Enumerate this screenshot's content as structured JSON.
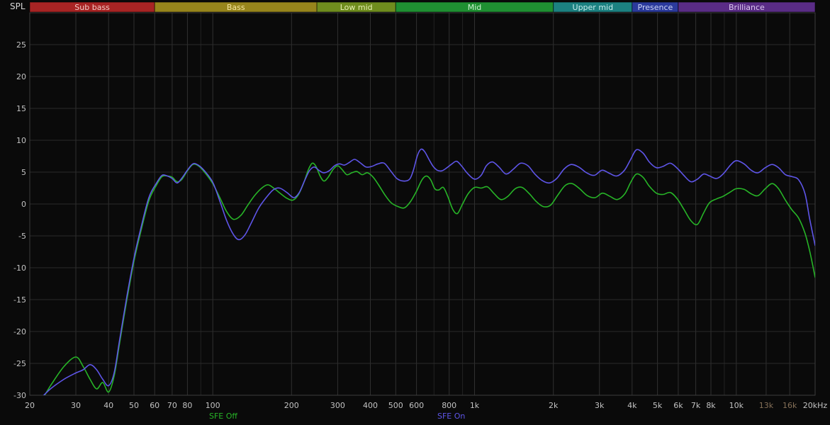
{
  "chart_data": {
    "type": "line",
    "title": "",
    "ylabel": "SPL",
    "x_axis": {
      "scale": "log",
      "min": 20,
      "max": 20000,
      "gridlines": [
        20,
        30,
        40,
        50,
        60,
        70,
        80,
        90,
        100,
        200,
        300,
        400,
        500,
        600,
        700,
        800,
        900,
        1000,
        2000,
        3000,
        4000,
        5000,
        6000,
        7000,
        8000,
        9000,
        10000,
        13000,
        16000,
        20000
      ],
      "tick_labels": [
        {
          "f": 20,
          "label": "20"
        },
        {
          "f": 30,
          "label": "30"
        },
        {
          "f": 40,
          "label": "40"
        },
        {
          "f": 50,
          "label": "50"
        },
        {
          "f": 60,
          "label": "60"
        },
        {
          "f": 70,
          "label": "70"
        },
        {
          "f": 80,
          "label": "80"
        },
        {
          "f": 100,
          "label": "100"
        },
        {
          "f": 200,
          "label": "200"
        },
        {
          "f": 300,
          "label": "300"
        },
        {
          "f": 400,
          "label": "400"
        },
        {
          "f": 500,
          "label": "500"
        },
        {
          "f": 600,
          "label": "600"
        },
        {
          "f": 800,
          "label": "800"
        },
        {
          "f": 1000,
          "label": "1k"
        },
        {
          "f": 2000,
          "label": "2k"
        },
        {
          "f": 3000,
          "label": "3k"
        },
        {
          "f": 4000,
          "label": "4k"
        },
        {
          "f": 5000,
          "label": "5k"
        },
        {
          "f": 6000,
          "label": "6k"
        },
        {
          "f": 7000,
          "label": "7k"
        },
        {
          "f": 8000,
          "label": "8k"
        },
        {
          "f": 10000,
          "label": "10k"
        },
        {
          "f": 13000,
          "label": "13k",
          "dim": true
        },
        {
          "f": 16000,
          "label": "16k",
          "dim": true
        },
        {
          "f": 20000,
          "label": "20kHz"
        }
      ]
    },
    "y_axis": {
      "min": -30,
      "max": 30,
      "step": 5,
      "labels": [
        25,
        20,
        15,
        10,
        5,
        0,
        -5,
        -10,
        -15,
        -20,
        -25,
        -30
      ]
    },
    "bands": [
      {
        "label": "Sub bass",
        "from": 20,
        "to": 60,
        "color": "#a82424",
        "text_color": "#f2ccc6"
      },
      {
        "label": "Bass",
        "from": 60,
        "to": 250,
        "color": "#97851c",
        "text_color": "#f5e6a0"
      },
      {
        "label": "Low mid",
        "from": 250,
        "to": 500,
        "color": "#6f8d1e",
        "text_color": "#e6f0b2"
      },
      {
        "label": "Mid",
        "from": 500,
        "to": 2000,
        "color": "#1f9032",
        "text_color": "#ccf2d0"
      },
      {
        "label": "Upper mid",
        "from": 2000,
        "to": 4000,
        "color": "#1c8181",
        "text_color": "#c6ecec"
      },
      {
        "label": "Presence",
        "from": 4000,
        "to": 6000,
        "color": "#2b3a9c",
        "text_color": "#ccd4f5"
      },
      {
        "label": "Brilliance",
        "from": 6000,
        "to": 20000,
        "color": "#5a2c86",
        "text_color": "#ddc9f0"
      }
    ],
    "series": [
      {
        "name": "SFE Off",
        "color": "#27b427",
        "points": [
          [
            20,
            -33
          ],
          [
            22,
            -31
          ],
          [
            24,
            -28.5
          ],
          [
            27,
            -25.5
          ],
          [
            30,
            -24
          ],
          [
            32,
            -25.5
          ],
          [
            34,
            -27.5
          ],
          [
            36,
            -29
          ],
          [
            38,
            -28
          ],
          [
            40,
            -29.5
          ],
          [
            42,
            -27
          ],
          [
            44,
            -22
          ],
          [
            47,
            -15
          ],
          [
            50,
            -9
          ],
          [
            53,
            -4.5
          ],
          [
            57,
            0.5
          ],
          [
            61,
            3
          ],
          [
            64,
            4.3
          ],
          [
            67,
            4.4
          ],
          [
            70,
            4.2
          ],
          [
            73,
            3.5
          ],
          [
            76,
            3.8
          ],
          [
            80,
            5.2
          ],
          [
            84,
            6.2
          ],
          [
            88,
            6
          ],
          [
            93,
            5
          ],
          [
            100,
            3.2
          ],
          [
            107,
            0.8
          ],
          [
            113,
            -1.2
          ],
          [
            120,
            -2.4
          ],
          [
            128,
            -1.8
          ],
          [
            136,
            -0.2
          ],
          [
            145,
            1.4
          ],
          [
            155,
            2.6
          ],
          [
            163,
            3
          ],
          [
            172,
            2.4
          ],
          [
            182,
            1.6
          ],
          [
            192,
            0.9
          ],
          [
            202,
            0.6
          ],
          [
            212,
            1.4
          ],
          [
            222,
            3.2
          ],
          [
            232,
            5.4
          ],
          [
            240,
            6.4
          ],
          [
            248,
            5.9
          ],
          [
            257,
            4.4
          ],
          [
            266,
            3.6
          ],
          [
            276,
            4.2
          ],
          [
            288,
            5.4
          ],
          [
            300,
            6
          ],
          [
            312,
            5.4
          ],
          [
            325,
            4.6
          ],
          [
            340,
            4.9
          ],
          [
            355,
            5.1
          ],
          [
            372,
            4.6
          ],
          [
            390,
            4.9
          ],
          [
            410,
            4.2
          ],
          [
            430,
            3
          ],
          [
            455,
            1.4
          ],
          [
            480,
            0.2
          ],
          [
            510,
            -0.4
          ],
          [
            540,
            -0.6
          ],
          [
            570,
            0.4
          ],
          [
            600,
            2
          ],
          [
            630,
            3.8
          ],
          [
            655,
            4.4
          ],
          [
            680,
            3.8
          ],
          [
            705,
            2.4
          ],
          [
            730,
            2.2
          ],
          [
            760,
            2.6
          ],
          [
            790,
            1.2
          ],
          [
            825,
            -0.8
          ],
          [
            860,
            -1.5
          ],
          [
            900,
            0
          ],
          [
            945,
            1.6
          ],
          [
            1000,
            2.6
          ],
          [
            1060,
            2.5
          ],
          [
            1120,
            2.7
          ],
          [
            1190,
            1.6
          ],
          [
            1260,
            0.7
          ],
          [
            1340,
            1.2
          ],
          [
            1430,
            2.4
          ],
          [
            1520,
            2.6
          ],
          [
            1620,
            1.6
          ],
          [
            1720,
            0.4
          ],
          [
            1830,
            -0.4
          ],
          [
            1950,
            -0.2
          ],
          [
            2080,
            1.4
          ],
          [
            2220,
            2.9
          ],
          [
            2360,
            3.2
          ],
          [
            2520,
            2.4
          ],
          [
            2700,
            1.3
          ],
          [
            2890,
            1
          ],
          [
            3080,
            1.7
          ],
          [
            3290,
            1.2
          ],
          [
            3510,
            0.7
          ],
          [
            3750,
            1.6
          ],
          [
            3950,
            3.4
          ],
          [
            4150,
            4.7
          ],
          [
            4400,
            4.2
          ],
          [
            4650,
            2.8
          ],
          [
            4950,
            1.7
          ],
          [
            5250,
            1.5
          ],
          [
            5600,
            1.8
          ],
          [
            5950,
            0.8
          ],
          [
            6300,
            -0.8
          ],
          [
            6700,
            -2.6
          ],
          [
            7100,
            -3.2
          ],
          [
            7500,
            -1.4
          ],
          [
            7900,
            0.2
          ],
          [
            8400,
            0.8
          ],
          [
            8900,
            1.2
          ],
          [
            9500,
            1.9
          ],
          [
            10000,
            2.4
          ],
          [
            10700,
            2.3
          ],
          [
            11400,
            1.6
          ],
          [
            12100,
            1.3
          ],
          [
            12900,
            2.4
          ],
          [
            13700,
            3.2
          ],
          [
            14500,
            2.4
          ],
          [
            15400,
            0.6
          ],
          [
            16300,
            -0.9
          ],
          [
            17300,
            -2.2
          ],
          [
            18300,
            -4.6
          ],
          [
            19100,
            -7.5
          ],
          [
            20000,
            -11.5
          ]
        ]
      },
      {
        "name": "SFE On",
        "color": "#5e55e8",
        "points": [
          [
            20,
            -32
          ],
          [
            22,
            -30.5
          ],
          [
            24,
            -29
          ],
          [
            27,
            -27.5
          ],
          [
            30,
            -26.5
          ],
          [
            32,
            -26
          ],
          [
            34,
            -25.2
          ],
          [
            36,
            -26
          ],
          [
            38,
            -27.5
          ],
          [
            40,
            -28.5
          ],
          [
            42,
            -26.5
          ],
          [
            44,
            -21.5
          ],
          [
            47,
            -14.5
          ],
          [
            50,
            -8.5
          ],
          [
            53,
            -4
          ],
          [
            57,
            1
          ],
          [
            61,
            3.3
          ],
          [
            64,
            4.5
          ],
          [
            67,
            4.4
          ],
          [
            70,
            4
          ],
          [
            73,
            3.3
          ],
          [
            76,
            4
          ],
          [
            80,
            5.3
          ],
          [
            84,
            6.3
          ],
          [
            88,
            6.1
          ],
          [
            93,
            5.2
          ],
          [
            100,
            3.4
          ],
          [
            107,
            0.2
          ],
          [
            113,
            -2.6
          ],
          [
            120,
            -4.8
          ],
          [
            126,
            -5.6
          ],
          [
            133,
            -4.8
          ],
          [
            141,
            -2.8
          ],
          [
            150,
            -0.6
          ],
          [
            160,
            1
          ],
          [
            170,
            2.2
          ],
          [
            180,
            2.5
          ],
          [
            192,
            1.8
          ],
          [
            204,
            1
          ],
          [
            214,
            1.8
          ],
          [
            224,
            3.6
          ],
          [
            234,
            5.2
          ],
          [
            244,
            5.8
          ],
          [
            254,
            5.3
          ],
          [
            265,
            4.9
          ],
          [
            278,
            5.2
          ],
          [
            292,
            6
          ],
          [
            305,
            6.3
          ],
          [
            318,
            6.1
          ],
          [
            332,
            6.5
          ],
          [
            348,
            7
          ],
          [
            365,
            6.5
          ],
          [
            385,
            5.8
          ],
          [
            405,
            5.9
          ],
          [
            428,
            6.3
          ],
          [
            452,
            6.4
          ],
          [
            478,
            5.2
          ],
          [
            505,
            4
          ],
          [
            535,
            3.6
          ],
          [
            565,
            3.9
          ],
          [
            585,
            5.4
          ],
          [
            605,
            7.6
          ],
          [
            625,
            8.6
          ],
          [
            645,
            8.2
          ],
          [
            670,
            7
          ],
          [
            695,
            5.9
          ],
          [
            720,
            5.3
          ],
          [
            750,
            5.2
          ],
          [
            785,
            5.7
          ],
          [
            820,
            6.3
          ],
          [
            855,
            6.7
          ],
          [
            895,
            5.9
          ],
          [
            940,
            4.8
          ],
          [
            1000,
            3.9
          ],
          [
            1060,
            4.5
          ],
          [
            1110,
            6
          ],
          [
            1170,
            6.6
          ],
          [
            1240,
            5.8
          ],
          [
            1320,
            4.7
          ],
          [
            1410,
            5.5
          ],
          [
            1500,
            6.4
          ],
          [
            1600,
            6
          ],
          [
            1700,
            4.7
          ],
          [
            1810,
            3.7
          ],
          [
            1930,
            3.3
          ],
          [
            2060,
            4
          ],
          [
            2200,
            5.5
          ],
          [
            2340,
            6.2
          ],
          [
            2500,
            5.8
          ],
          [
            2680,
            4.9
          ],
          [
            2870,
            4.5
          ],
          [
            3070,
            5.3
          ],
          [
            3280,
            4.8
          ],
          [
            3500,
            4.4
          ],
          [
            3740,
            5.3
          ],
          [
            3950,
            7
          ],
          [
            4150,
            8.5
          ],
          [
            4400,
            8
          ],
          [
            4650,
            6.6
          ],
          [
            4950,
            5.7
          ],
          [
            5250,
            5.9
          ],
          [
            5600,
            6.4
          ],
          [
            5950,
            5.6
          ],
          [
            6300,
            4.5
          ],
          [
            6700,
            3.5
          ],
          [
            7100,
            3.9
          ],
          [
            7500,
            4.7
          ],
          [
            7900,
            4.4
          ],
          [
            8400,
            4
          ],
          [
            8900,
            4.7
          ],
          [
            9500,
            6.1
          ],
          [
            10000,
            6.8
          ],
          [
            10700,
            6.3
          ],
          [
            11400,
            5.3
          ],
          [
            12100,
            4.9
          ],
          [
            12900,
            5.7
          ],
          [
            13700,
            6.2
          ],
          [
            14500,
            5.7
          ],
          [
            15400,
            4.6
          ],
          [
            16300,
            4.3
          ],
          [
            17300,
            3.8
          ],
          [
            18300,
            1.6
          ],
          [
            19100,
            -2.5
          ],
          [
            20000,
            -6.5
          ]
        ]
      }
    ],
    "legend": {
      "position": "bottom"
    },
    "grid": {
      "on": true,
      "major_color": "#303030",
      "minor_color": "#222222",
      "h_color": "#2a2a2a",
      "border_color": "#3c3c3c"
    },
    "colors": {
      "background": "#0a0a0a",
      "axis_text": "#c2c2c2",
      "dim_axis_text": "#857058"
    }
  }
}
